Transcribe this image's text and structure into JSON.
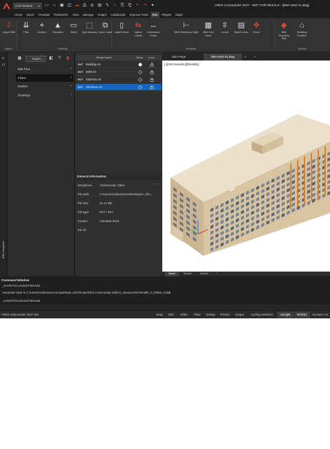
{
  "app": {
    "title": "ARES Commander 2027 - NOT FOR RESALE - [BIM Hotel 01.dwg]",
    "workspace": "CAD General"
  },
  "menu_tabs": [
    "Home",
    "Insert",
    "Annotate",
    "Parametric",
    "View",
    "Manage",
    "Output",
    "Collaborate",
    "Express Tools",
    "BIM",
    "Plugins",
    "Maps"
  ],
  "active_menu": "BIM",
  "ribbon": {
    "buttons": [
      {
        "label": "Import BIM",
        "icon": "import-bim-icon"
      },
      {
        "label": "Plan",
        "icon": "plan-icon"
      },
      {
        "label": "Section",
        "icon": "section-icon"
      },
      {
        "label": "Elevation",
        "icon": "elevation-icon"
      },
      {
        "label": "Sheet",
        "icon": "sheet-icon"
      },
      {
        "label": "Split drawing",
        "icon": "split-drawing-icon"
      },
      {
        "label": "Insert Label",
        "icon": "insert-label-icon"
      },
      {
        "label": "Label Doors",
        "icon": "label-doors-icon"
      },
      {
        "label": "Adjust Labels",
        "icon": "adjust-labels-icon"
      },
      {
        "label": "Dimension Chain",
        "icon": "dimension-chain-icon"
      },
      {
        "label": "BIM Dimension Style",
        "icon": "bim-dimension-style-icon"
      },
      {
        "label": "BIM Grid Lines",
        "icon": "bim-grid-lines-icon"
      },
      {
        "label": "Levels",
        "icon": "levels-icon"
      },
      {
        "label": "Match Lines",
        "icon": "match-lines-icon"
      },
      {
        "label": "Move",
        "icon": "move-icon"
      },
      {
        "label": "BIM Geometry Edit",
        "icon": "bim-geometry-edit-icon"
      },
      {
        "label": "Building Position",
        "icon": "building-position-icon"
      }
    ],
    "groups": [
      "Import",
      "Drawing",
      "Annotate",
      "Modify"
    ]
  },
  "navigator": {
    "title": "BIM Navigator",
    "import_label": "Import...",
    "items": [
      {
        "label": "BIM Files"
      },
      {
        "label": "Filters"
      },
      {
        "label": "Entities"
      },
      {
        "label": "Drawings"
      }
    ],
    "selected_index": 1
  },
  "model_list": {
    "headers": [
      "Model Name",
      "Show",
      "Lock"
    ],
    "rows": [
      {
        "tag": "RVT",
        "name": "Building.rvt",
        "shown": true
      },
      {
        "tag": "RVT",
        "name": "MEP.rvt",
        "shown": false
      },
      {
        "tag": "RVT",
        "name": "SitePlan.rvt",
        "shown": false
      },
      {
        "tag": "RVT",
        "name": "Structure.rvt",
        "shown": false,
        "selected": true
      }
    ]
  },
  "general_info": {
    "title": "General Information",
    "fields": [
      {
        "key": "Disciplines:",
        "value": "Architectural, Other"
      },
      {
        "key": "File path:",
        "value": "C:\\Users\\Andreea\\cimo\\Desktop\\A_Sho..."
      },
      {
        "key": "File size:",
        "value": "31.14 MB"
      },
      {
        "key": "File type:",
        "value": "RVT / RFA"
      },
      {
        "key": "Creator:",
        "value": "Autodesk Revit"
      },
      {
        "key": "File ID:",
        "value": ""
      }
    ]
  },
  "doc_tabs": [
    "Start Page",
    "BIM Hotel 01.dwg"
  ],
  "viewport_label": "[-][SW Isometric][Realistic]",
  "layout_tabs": [
    "Model",
    "Sheet1",
    "Sheet2"
  ],
  "command": {
    "title": "Command Window",
    "lines": [
      "_SAVETOCLOUDSTORAGE",
      "Automatic save to C:\\Users\\Andreea\\ecno\\AppData\\Local\\Temp\\ARES Commander Edition_autosave\\NONAME_0_52916_0.ds$",
      "_SAVETOCLOUDSTORAGE"
    ]
  },
  "status": {
    "version": "ARES Commander 2027 x64",
    "toggles": [
      "Snap",
      "Grid",
      "Ortho",
      "Polar",
      "ESnap",
      "ETrack",
      "QInput",
      "Cycling Selection",
      "LWeight",
      "MODEL",
      "Dynamic CC"
    ]
  },
  "colors": {
    "accent_red": "#e0482e",
    "selection_blue": "#1565c0",
    "building": "#d9c6a5"
  }
}
